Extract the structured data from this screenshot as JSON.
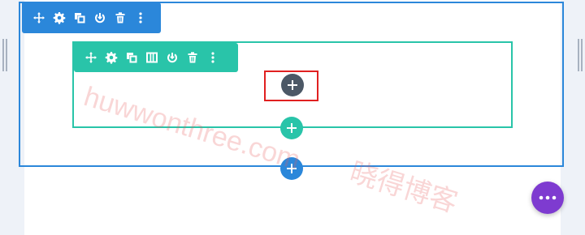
{
  "colors": {
    "section_accent": "#2b87da",
    "row_accent": "#29c4a9",
    "module_add": "#4c5866",
    "fab": "#7e3bd0",
    "highlight": "#e02020"
  },
  "section_toolbar": {
    "icons": [
      "move-icon",
      "settings-icon",
      "duplicate-icon",
      "save-icon",
      "delete-icon",
      "more-icon"
    ]
  },
  "row_toolbar": {
    "icons": [
      "move-icon",
      "settings-icon",
      "duplicate-icon",
      "columns-icon",
      "save-icon",
      "delete-icon",
      "more-icon"
    ]
  },
  "buttons": {
    "add_module": "+",
    "add_row": "+",
    "add_section": "+"
  },
  "watermark": {
    "url": "huwwonthree.com",
    "text": "晓得博客"
  }
}
